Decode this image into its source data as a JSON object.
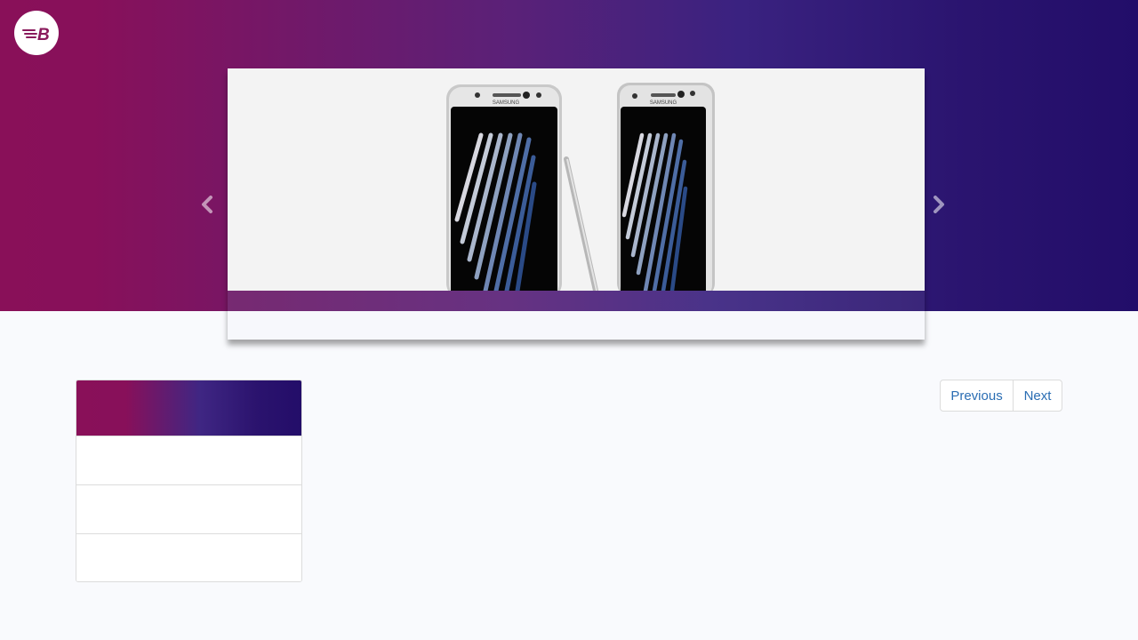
{
  "header": {
    "logo_icon": "bolt-b-logo-icon",
    "logo_letter": "B",
    "gradient_colors": [
      "#891059",
      "#5a2178",
      "#220d69"
    ]
  },
  "carousel": {
    "slide_image": "two-smartphones-with-stylus",
    "brand_text": "SAMSUNG",
    "caption": "",
    "prev_icon": "chevron-left-icon",
    "next_icon": "chevron-right-icon"
  },
  "sidebar": {
    "header_title": "",
    "items": [
      {
        "label": ""
      },
      {
        "label": ""
      },
      {
        "label": ""
      }
    ]
  },
  "pagination": {
    "previous_label": "Previous",
    "next_label": "Next",
    "link_color": "#2a6db3"
  }
}
